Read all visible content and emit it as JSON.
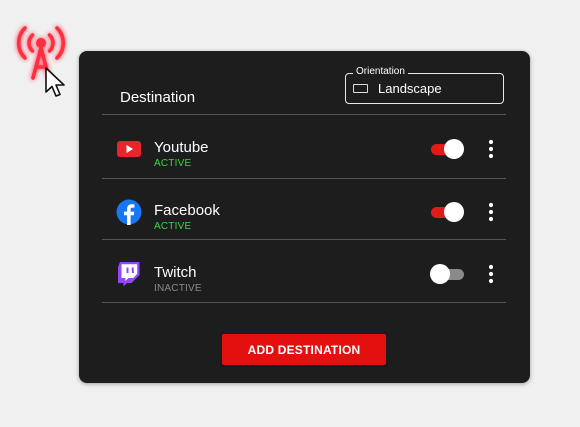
{
  "app": {
    "broadcast_icon": "broadcast-tower-icon",
    "cursor_icon": "mouse-pointer-icon"
  },
  "panel": {
    "title": "Destination",
    "orientation": {
      "legend": "Orientation",
      "value": "Landscape",
      "icon": "landscape-icon"
    },
    "destinations": [
      {
        "name": "Youtube",
        "status": "ACTIVE",
        "enabled": true,
        "icon": "youtube-icon",
        "brand_color": "#e8262a"
      },
      {
        "name": "Facebook",
        "status": "ACTIVE",
        "enabled": true,
        "icon": "facebook-icon",
        "brand_color": "#1877f2"
      },
      {
        "name": "Twitch",
        "status": "INACTIVE",
        "enabled": false,
        "icon": "twitch-icon",
        "brand_color": "#9146ff"
      }
    ],
    "add_button_label": "ADD DESTINATION"
  },
  "colors": {
    "background": "#f0f0f0",
    "panel": "#1d1d1d",
    "accent": "#e40f0f",
    "active_status": "#3fd24a",
    "inactive_status": "#8a8a8a"
  }
}
